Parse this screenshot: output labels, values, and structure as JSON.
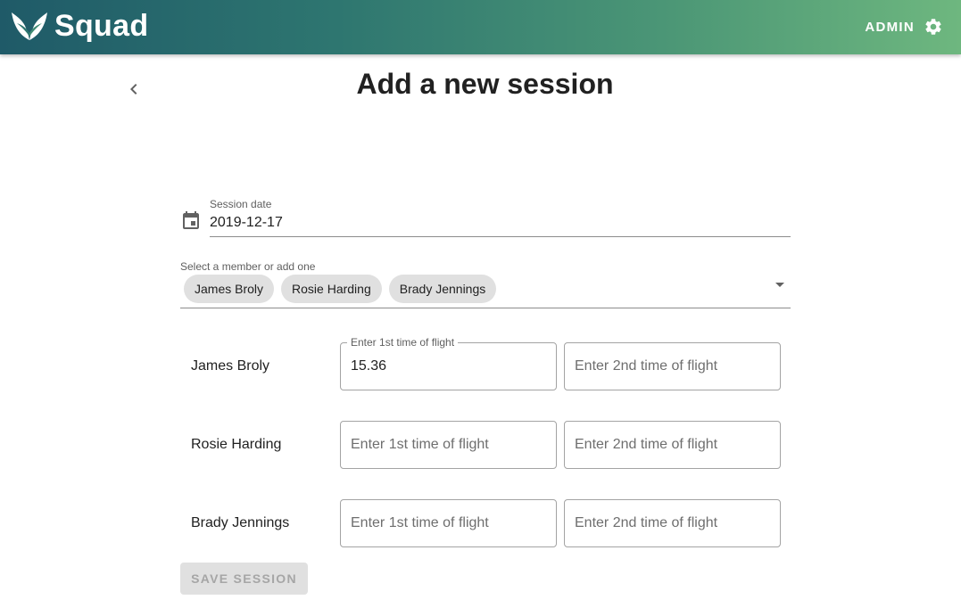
{
  "app": {
    "brand": "Squad",
    "admin_label": "ADMIN"
  },
  "icons": {
    "logo": "leaf-wings-logo",
    "settings": "gear-icon",
    "back": "chevron-left-icon",
    "calendar": "calendar-icon",
    "dropdown": "arrow-drop-down-icon"
  },
  "page": {
    "title": "Add a new session"
  },
  "session_date": {
    "label": "Session date",
    "value": "2019-12-17"
  },
  "members": {
    "label": "Select a member or add one",
    "chips": [
      "James Broly",
      "Rosie Harding",
      "Brady Jennings"
    ]
  },
  "rows": [
    {
      "name": "James Broly",
      "flight1": {
        "label": "Enter 1st time of flight",
        "value": "15.36",
        "placeholder": ""
      },
      "flight2": {
        "value": "",
        "placeholder": "Enter 2nd time of flight"
      }
    },
    {
      "name": "Rosie Harding",
      "flight1": {
        "value": "",
        "placeholder": "Enter 1st time of flight"
      },
      "flight2": {
        "value": "",
        "placeholder": "Enter 2nd time of flight"
      }
    },
    {
      "name": "Brady Jennings",
      "flight1": {
        "value": "",
        "placeholder": "Enter 1st time of flight"
      },
      "flight2": {
        "value": "",
        "placeholder": "Enter 2nd time of flight"
      }
    }
  ],
  "save_button": {
    "label": "SAVE SESSION",
    "disabled": true
  },
  "colors": {
    "appbar_start": "#1f5a68",
    "appbar_end": "#6eb77f",
    "chip_bg": "#e0e0e0",
    "button_disabled_bg": "#e0e0e0",
    "button_disabled_text": "#a6a6a6"
  }
}
